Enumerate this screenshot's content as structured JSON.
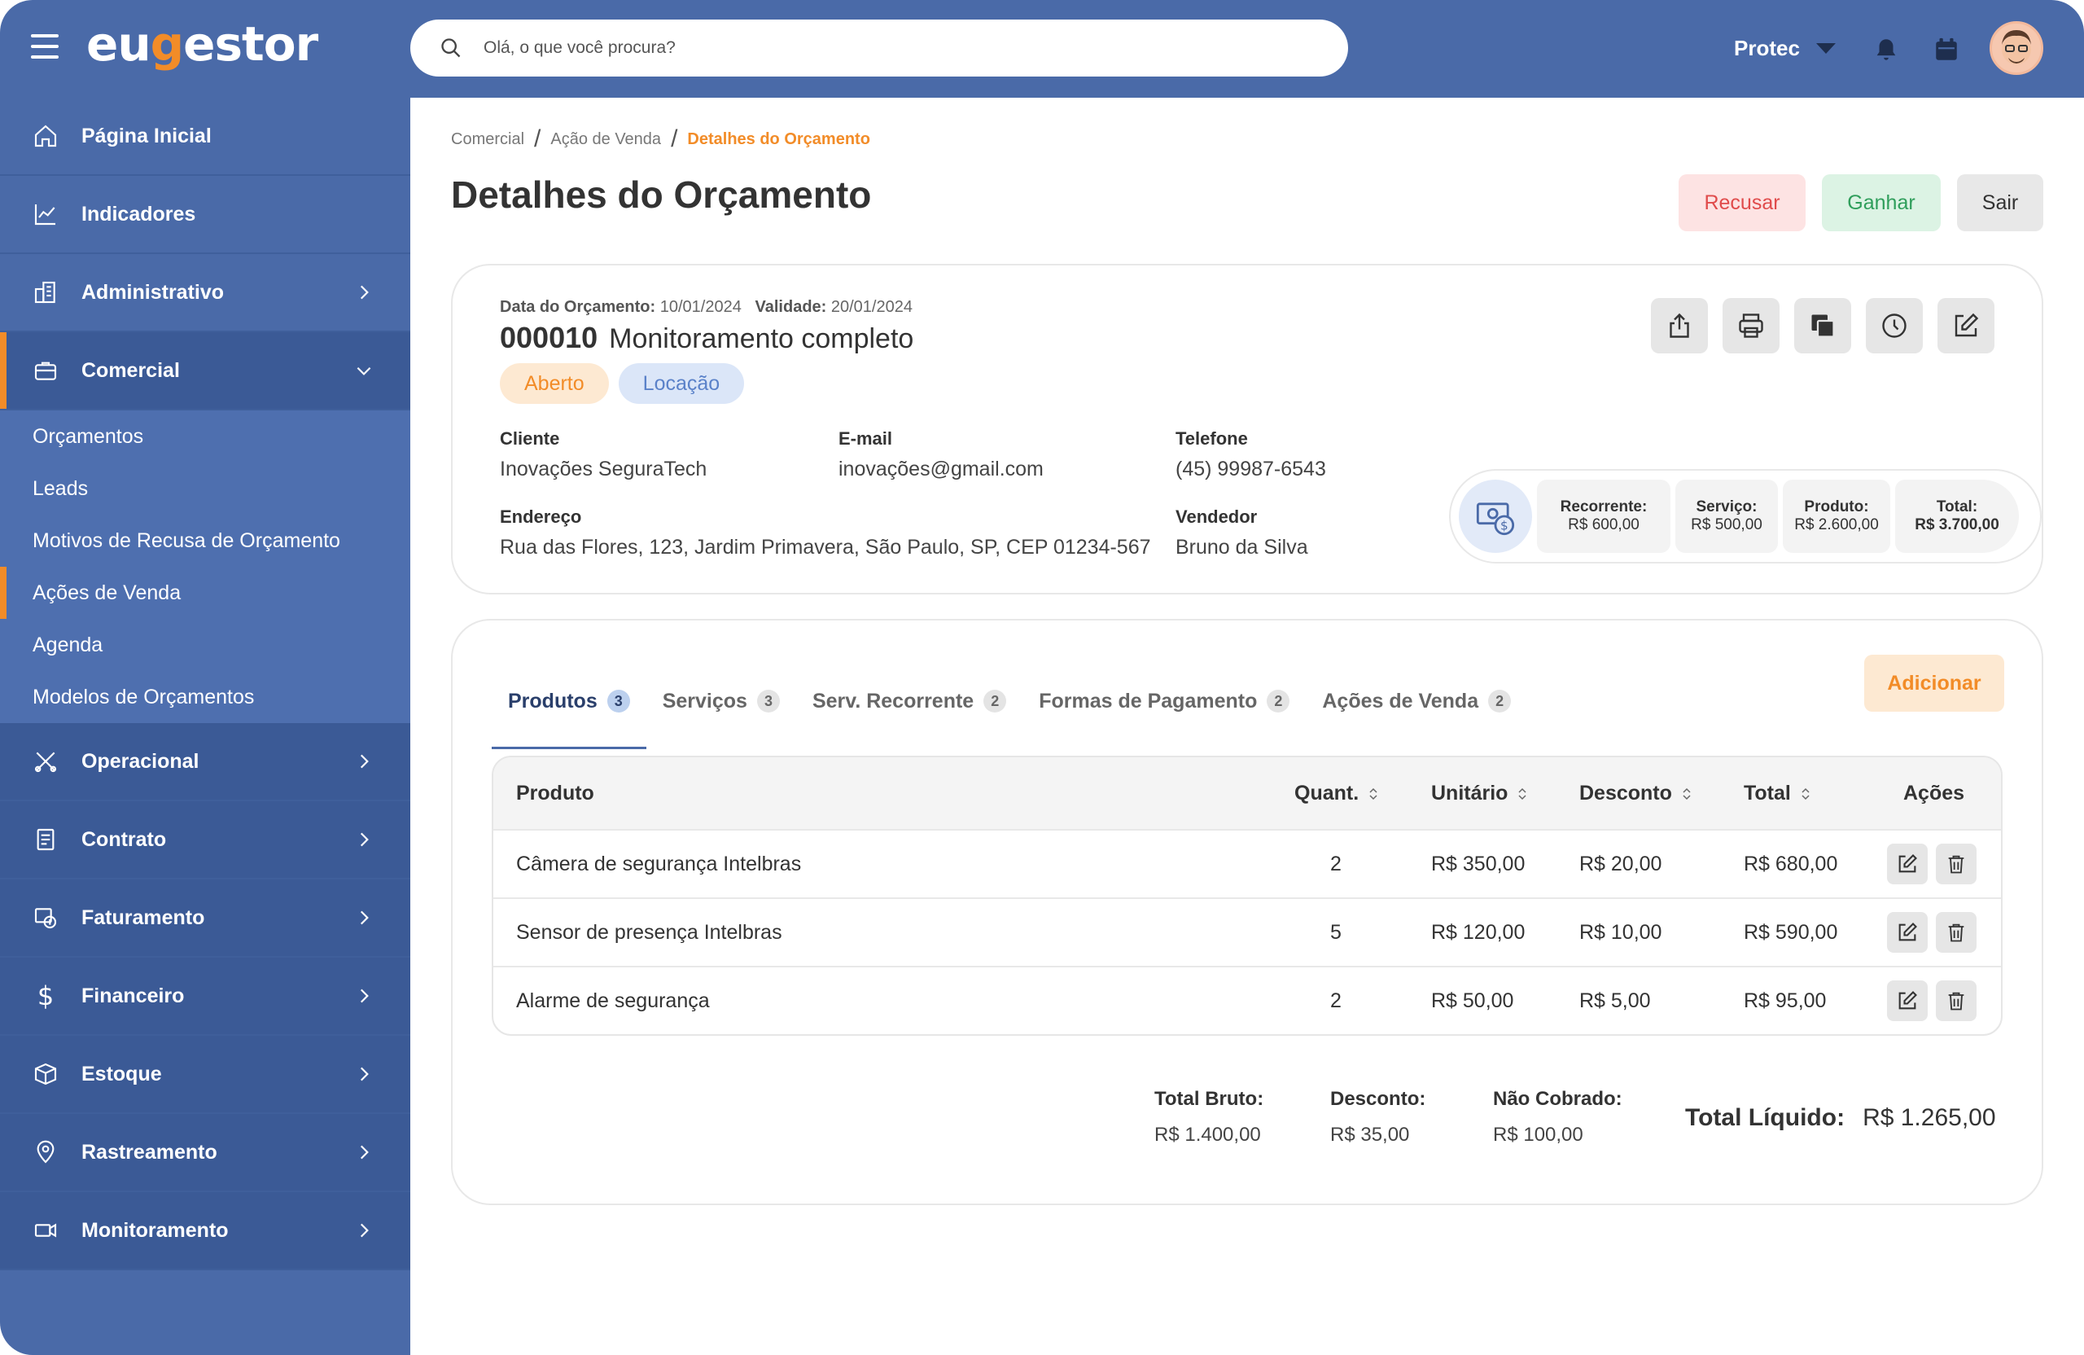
{
  "app": {
    "logo_pre": "eu",
    "logo_g": "g",
    "logo_post": "estor"
  },
  "search": {
    "placeholder": "Olá, o que você procura?"
  },
  "header": {
    "company": "Protec"
  },
  "sidebar": {
    "items": [
      {
        "label": "Página Inicial"
      },
      {
        "label": "Indicadores"
      },
      {
        "label": "Administrativo"
      },
      {
        "label": "Comercial"
      },
      {
        "label": "Operacional"
      },
      {
        "label": "Contrato"
      },
      {
        "label": "Faturamento"
      },
      {
        "label": "Financeiro"
      },
      {
        "label": "Estoque"
      },
      {
        "label": "Rastreamento"
      },
      {
        "label": "Monitoramento"
      }
    ],
    "submenu": [
      {
        "label": "Orçamentos"
      },
      {
        "label": "Leads"
      },
      {
        "label": "Motivos de Recusa de Orçamento"
      },
      {
        "label": "Ações de Venda"
      },
      {
        "label": "Agenda"
      },
      {
        "label": "Modelos de Orçamentos"
      }
    ]
  },
  "breadcrumb": {
    "items": [
      "Comercial",
      "Ação de Venda",
      "Detalhes do Orçamento"
    ],
    "sep": "/"
  },
  "page": {
    "title": "Detalhes do Orçamento"
  },
  "actions": {
    "recusar": "Recusar",
    "ganhar": "Ganhar",
    "sair": "Sair"
  },
  "quote": {
    "date_label": "Data do Orçamento:",
    "date": "10/01/2024",
    "valid_label": "Validade:",
    "valid": "20/01/2024",
    "number": "000010",
    "name": "Monitoramento completo",
    "status": "Aberto",
    "type": "Locação",
    "fields": {
      "cliente_label": "Cliente",
      "cliente": "Inovações SeguraTech",
      "email_label": "E-mail",
      "email": "inovações@gmail.com",
      "telefone_label": "Telefone",
      "telefone": "(45) 99987-6543",
      "endereco_label": "Endereço",
      "endereco": "Rua das Flores, 123, Jardim Primavera, São Paulo, SP, CEP 01234-567",
      "vendedor_label": "Vendedor",
      "vendedor": "Bruno da Silva"
    },
    "summary": {
      "recorrente_label": "Recorrente:",
      "recorrente": "R$ 600,00",
      "servico_label": "Serviço:",
      "servico": "R$ 500,00",
      "produto_label": "Produto:",
      "produto": "R$ 2.600,00",
      "total_label": "Total:",
      "total": "R$ 3.700,00"
    }
  },
  "tabs": [
    {
      "label": "Produtos",
      "count": "3"
    },
    {
      "label": "Serviços",
      "count": "3"
    },
    {
      "label": "Serv. Recorrente",
      "count": "2"
    },
    {
      "label": "Formas de Pagamento",
      "count": "2"
    },
    {
      "label": "Ações de Venda",
      "count": "2"
    }
  ],
  "add_button": "Adicionar",
  "table": {
    "headers": {
      "produto": "Produto",
      "quant": "Quant.",
      "unitario": "Unitário",
      "desconto": "Desconto",
      "total": "Total",
      "acoes": "Ações"
    },
    "rows": [
      {
        "produto": "Câmera de segurança Intelbras",
        "quant": "2",
        "unitario": "R$ 350,00",
        "desconto": "R$ 20,00",
        "total": "R$ 680,00"
      },
      {
        "produto": "Sensor de presença Intelbras",
        "quant": "5",
        "unitario": "R$ 120,00",
        "desconto": "R$ 10,00",
        "total": "R$ 590,00"
      },
      {
        "produto": "Alarme de segurança",
        "quant": "2",
        "unitario": "R$ 50,00",
        "desconto": "R$ 5,00",
        "total": "R$ 95,00"
      }
    ]
  },
  "totals": {
    "bruto_label": "Total Bruto:",
    "bruto": "R$ 1.400,00",
    "desconto_label": "Desconto:",
    "desconto": "R$ 35,00",
    "nao_cobrado_label": "Não Cobrado:",
    "nao_cobrado": "R$ 100,00",
    "liquido_label": "Total Líquido:",
    "liquido": "R$ 1.265,00"
  },
  "colors": {
    "primary": "#4a6aa8",
    "accent": "#f28c28",
    "danger": "#e04b4b",
    "success": "#2f9e5b"
  }
}
